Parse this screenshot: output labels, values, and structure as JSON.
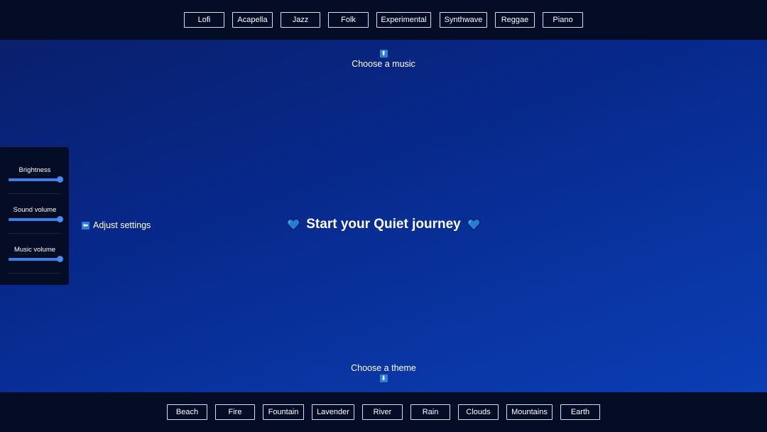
{
  "music_menu": {
    "items": [
      "Lofi",
      "Acapella",
      "Jazz",
      "Folk",
      "Experimental",
      "Synthwave",
      "Reggae",
      "Piano"
    ]
  },
  "theme_menu": {
    "items": [
      "Beach",
      "Fire",
      "Fountain",
      "Lavender",
      "River",
      "Rain",
      "Clouds",
      "Mountains",
      "Earth"
    ]
  },
  "hints": {
    "music": "Choose a music",
    "music_arrow": "⬆",
    "theme": "Choose a theme",
    "theme_arrow": "⬇",
    "settings": "Adjust settings",
    "settings_arrow": "⬅"
  },
  "headline": {
    "text": "Start your Quiet journey",
    "icon": "blue-heart-icon"
  },
  "settings": {
    "brightness": {
      "label": "Brightness",
      "value": 1.0
    },
    "sound_volume": {
      "label": "Sound volume",
      "value": 1.0
    },
    "music_volume": {
      "label": "Music volume",
      "value": 1.0
    }
  },
  "colors": {
    "bar_background": "#050d26",
    "accent": "#3d7ee8",
    "heart": "#1f7fe0"
  }
}
